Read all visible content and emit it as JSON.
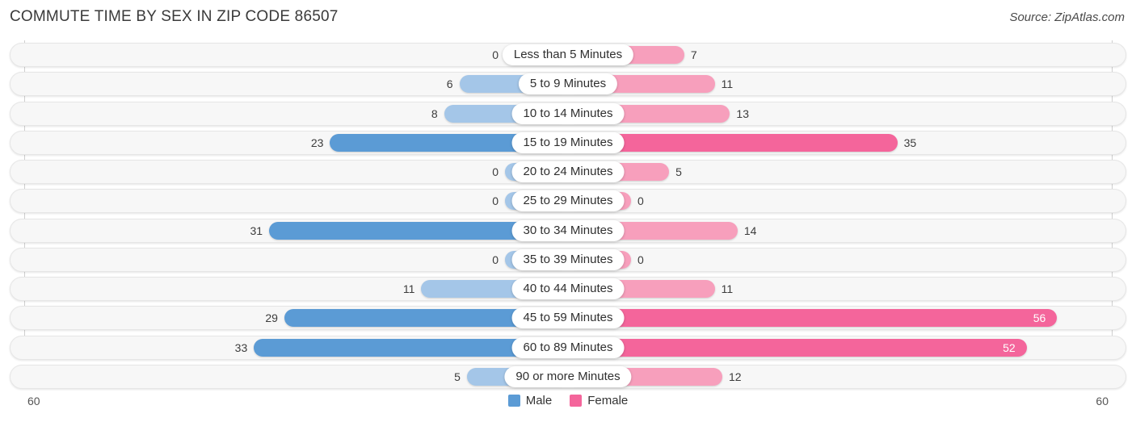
{
  "header": {
    "title": "COMMUTE TIME BY SEX IN ZIP CODE 86507",
    "source": "Source: ZipAtlas.com"
  },
  "axis": {
    "left_label": "60",
    "right_label": "60",
    "max": 60
  },
  "legend": {
    "items": [
      {
        "label": "Male",
        "color": "#5B9BD5"
      },
      {
        "label": "Female",
        "color": "#F4659B"
      }
    ]
  },
  "colors": {
    "male_strong": "#5B9BD5",
    "male_light": "#A4C6E8",
    "female_strong": "#F4659B",
    "female_light": "#F79FBC",
    "track_bg": "#f7f7f7",
    "track_border": "#e6e6e6"
  },
  "chart_data": {
    "type": "bar",
    "orientation": "horizontal-diverging",
    "title": "COMMUTE TIME BY SEX IN ZIP CODE 86507",
    "xlabel": "",
    "ylabel": "",
    "xlim": [
      60,
      60
    ],
    "grid": false,
    "legend_position": "bottom-center",
    "categories": [
      "Less than 5 Minutes",
      "5 to 9 Minutes",
      "10 to 14 Minutes",
      "15 to 19 Minutes",
      "20 to 24 Minutes",
      "25 to 29 Minutes",
      "30 to 34 Minutes",
      "35 to 39 Minutes",
      "40 to 44 Minutes",
      "45 to 59 Minutes",
      "60 to 89 Minutes",
      "90 or more Minutes"
    ],
    "series": [
      {
        "name": "Male",
        "values": [
          0,
          6,
          8,
          23,
          0,
          0,
          31,
          0,
          11,
          29,
          33,
          5
        ]
      },
      {
        "name": "Female",
        "values": [
          7,
          11,
          13,
          35,
          5,
          0,
          14,
          0,
          11,
          56,
          52,
          12
        ]
      }
    ]
  },
  "rows": [
    {
      "category": "Less than 5 Minutes",
      "male": "0",
      "female": "7"
    },
    {
      "category": "5 to 9 Minutes",
      "male": "6",
      "female": "11"
    },
    {
      "category": "10 to 14 Minutes",
      "male": "8",
      "female": "13"
    },
    {
      "category": "15 to 19 Minutes",
      "male": "23",
      "female": "35"
    },
    {
      "category": "20 to 24 Minutes",
      "male": "0",
      "female": "5"
    },
    {
      "category": "25 to 29 Minutes",
      "male": "0",
      "female": "0"
    },
    {
      "category": "30 to 34 Minutes",
      "male": "31",
      "female": "14"
    },
    {
      "category": "35 to 39 Minutes",
      "male": "0",
      "female": "0"
    },
    {
      "category": "40 to 44 Minutes",
      "male": "11",
      "female": "11"
    },
    {
      "category": "45 to 59 Minutes",
      "male": "29",
      "female": "56"
    },
    {
      "category": "60 to 89 Minutes",
      "male": "33",
      "female": "52"
    },
    {
      "category": "90 or more Minutes",
      "male": "5",
      "female": "12"
    }
  ]
}
